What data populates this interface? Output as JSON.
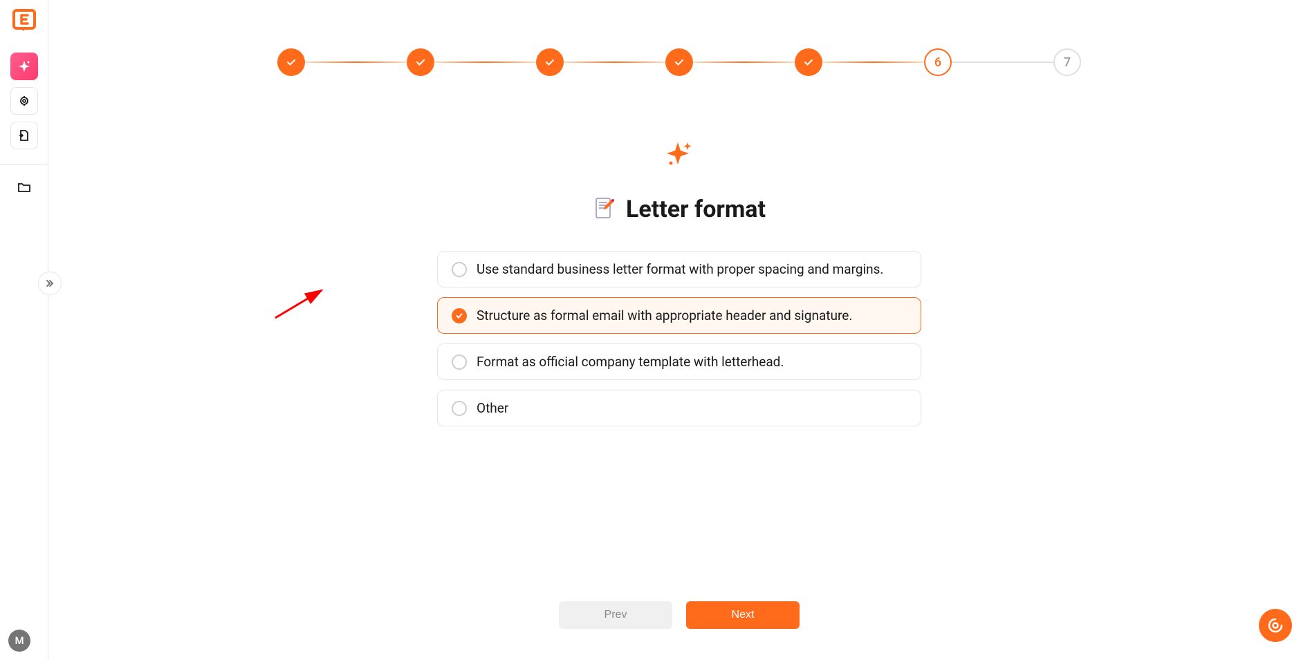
{
  "sidebar": {
    "avatar_initial": "M"
  },
  "stepper": {
    "steps": [
      {
        "state": "completed"
      },
      {
        "state": "completed"
      },
      {
        "state": "completed"
      },
      {
        "state": "completed"
      },
      {
        "state": "completed"
      },
      {
        "state": "current",
        "label": "6"
      },
      {
        "state": "upcoming",
        "label": "7"
      }
    ]
  },
  "content": {
    "title": "Letter format",
    "options": [
      {
        "label": "Use standard business letter format with proper spacing and margins.",
        "selected": false
      },
      {
        "label": "Structure as formal email with appropriate header and signature.",
        "selected": true
      },
      {
        "label": "Format as official company template with letterhead.",
        "selected": false
      },
      {
        "label": "Other",
        "selected": false
      }
    ]
  },
  "buttons": {
    "prev": "Prev",
    "next": "Next"
  }
}
